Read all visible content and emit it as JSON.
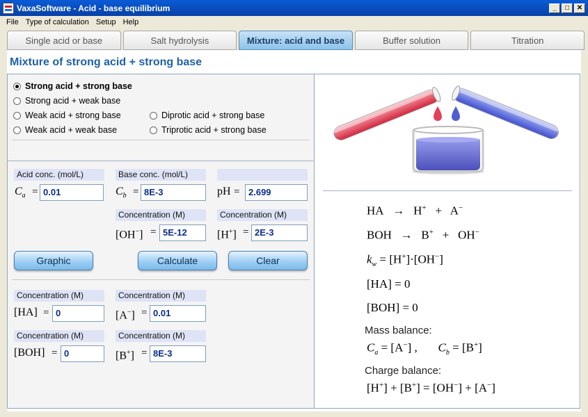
{
  "window": {
    "title": "VaxaSoftware - Acid - base equilibrium",
    "buttons": [
      "_",
      "□",
      "✕"
    ]
  },
  "menu": [
    "File",
    "Type of calculation",
    "Setup",
    "Help"
  ],
  "tabs": [
    {
      "label": "Single acid or base",
      "active": false
    },
    {
      "label": "Salt hydrolysis",
      "active": false
    },
    {
      "label": "Mixture: acid and base",
      "active": true
    },
    {
      "label": "Buffer solution",
      "active": false
    },
    {
      "label": "Titration",
      "active": false
    }
  ],
  "heading": "Mixture of strong acid + strong base",
  "options": [
    {
      "label": "Strong acid + strong base",
      "checked": true
    },
    {
      "label": "Strong acid + weak base",
      "checked": false
    },
    {
      "label": "Weak acid + strong base",
      "checked": false
    },
    {
      "label": "Weak acid + weak base",
      "checked": false
    },
    {
      "label": "Diprotic acid + strong base",
      "checked": false
    },
    {
      "label": "Triprotic acid + strong base",
      "checked": false
    }
  ],
  "inputs": {
    "acid_conc_label": "Acid conc. (mol/L)",
    "base_conc_label": "Base conc. (mol/L)",
    "ca_value": "0.01",
    "cb_value": "8E-3",
    "ph_label": "pH",
    "ph_value": "2.699",
    "oh_label": "Concentration (M)",
    "oh_value": "5E-12",
    "h_label": "Concentration (M)",
    "h_value": "2E-3"
  },
  "buttons": {
    "graphic": "Graphic",
    "calculate": "Calculate",
    "clear": "Clear"
  },
  "results": {
    "ha_label": "Concentration (M)",
    "ha_value": "0",
    "a_label": "Concentration (M)",
    "a_value": "0.01",
    "boh_label": "Concentration (M)",
    "boh_value": "0",
    "b_label": "Concentration (M)",
    "b_value": "8E-3"
  },
  "equations": {
    "ha_dissociation": [
      "HA",
      "→",
      "H",
      "+",
      "A"
    ],
    "boh_dissociation": [
      "BOH",
      "→",
      "B",
      "+",
      "OH"
    ],
    "kw": [
      "k",
      "w",
      "=",
      "[H",
      "]·[OH",
      "]"
    ],
    "ha_zero": "[HA]  =  0",
    "boh_zero": "[BOH]  =  0",
    "mass_balance": "Mass balance:",
    "charge_balance": "Charge balance:"
  },
  "colors": {
    "accent": "#1e62a8",
    "field_text": "#0b2e8a",
    "red_liquid": "#e3405a",
    "blue_liquid": "#4f5fd0"
  }
}
